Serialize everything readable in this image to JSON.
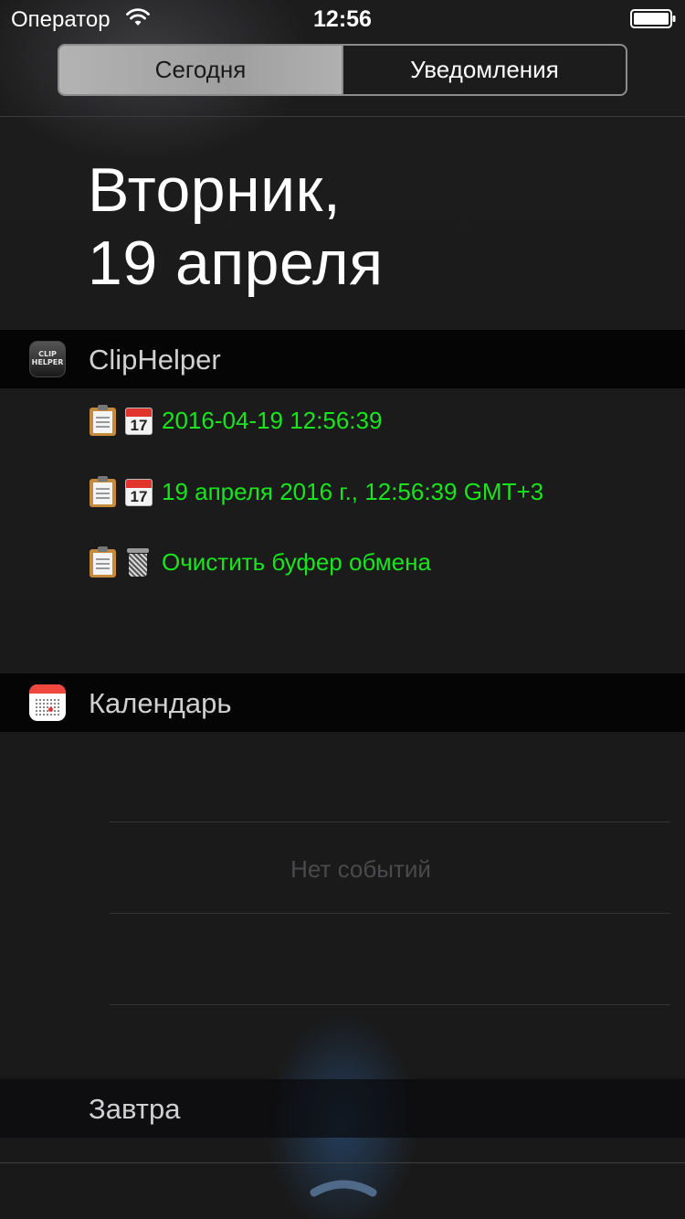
{
  "status_bar": {
    "carrier": "Оператор",
    "time": "12:56",
    "icons": [
      "wifi-icon",
      "battery-icon"
    ]
  },
  "segmented_control": {
    "tabs": [
      {
        "label": "Сегодня",
        "selected": true
      },
      {
        "label": "Уведомления",
        "selected": false
      }
    ]
  },
  "date_header": {
    "line1": "Вторник,",
    "line2": "19 апреля"
  },
  "cliphelper": {
    "title": "ClipHelper",
    "icon": "cliphelper-app-icon",
    "icon_text_1": "CLIP",
    "icon_text_2": "HELPER",
    "text_color": "#19e51d",
    "items": [
      {
        "icons": [
          "clipboard-icon",
          "calendar-17-icon"
        ],
        "calendar_day": "17",
        "label": "2016-04-19 12:56:39"
      },
      {
        "icons": [
          "clipboard-icon",
          "calendar-17-icon"
        ],
        "calendar_day": "17",
        "label": "19 апреля 2016 г., 12:56:39 GMT+3"
      },
      {
        "icons": [
          "clipboard-icon",
          "trash-icon"
        ],
        "label": "Очистить буфер обмена"
      }
    ]
  },
  "calendar": {
    "title": "Календарь",
    "icon": "calendar-app-icon",
    "empty_text": "Нет событий"
  },
  "tomorrow": {
    "label": "Завтра"
  },
  "footer": {
    "icon": "chevron-up-grabber-icon"
  }
}
